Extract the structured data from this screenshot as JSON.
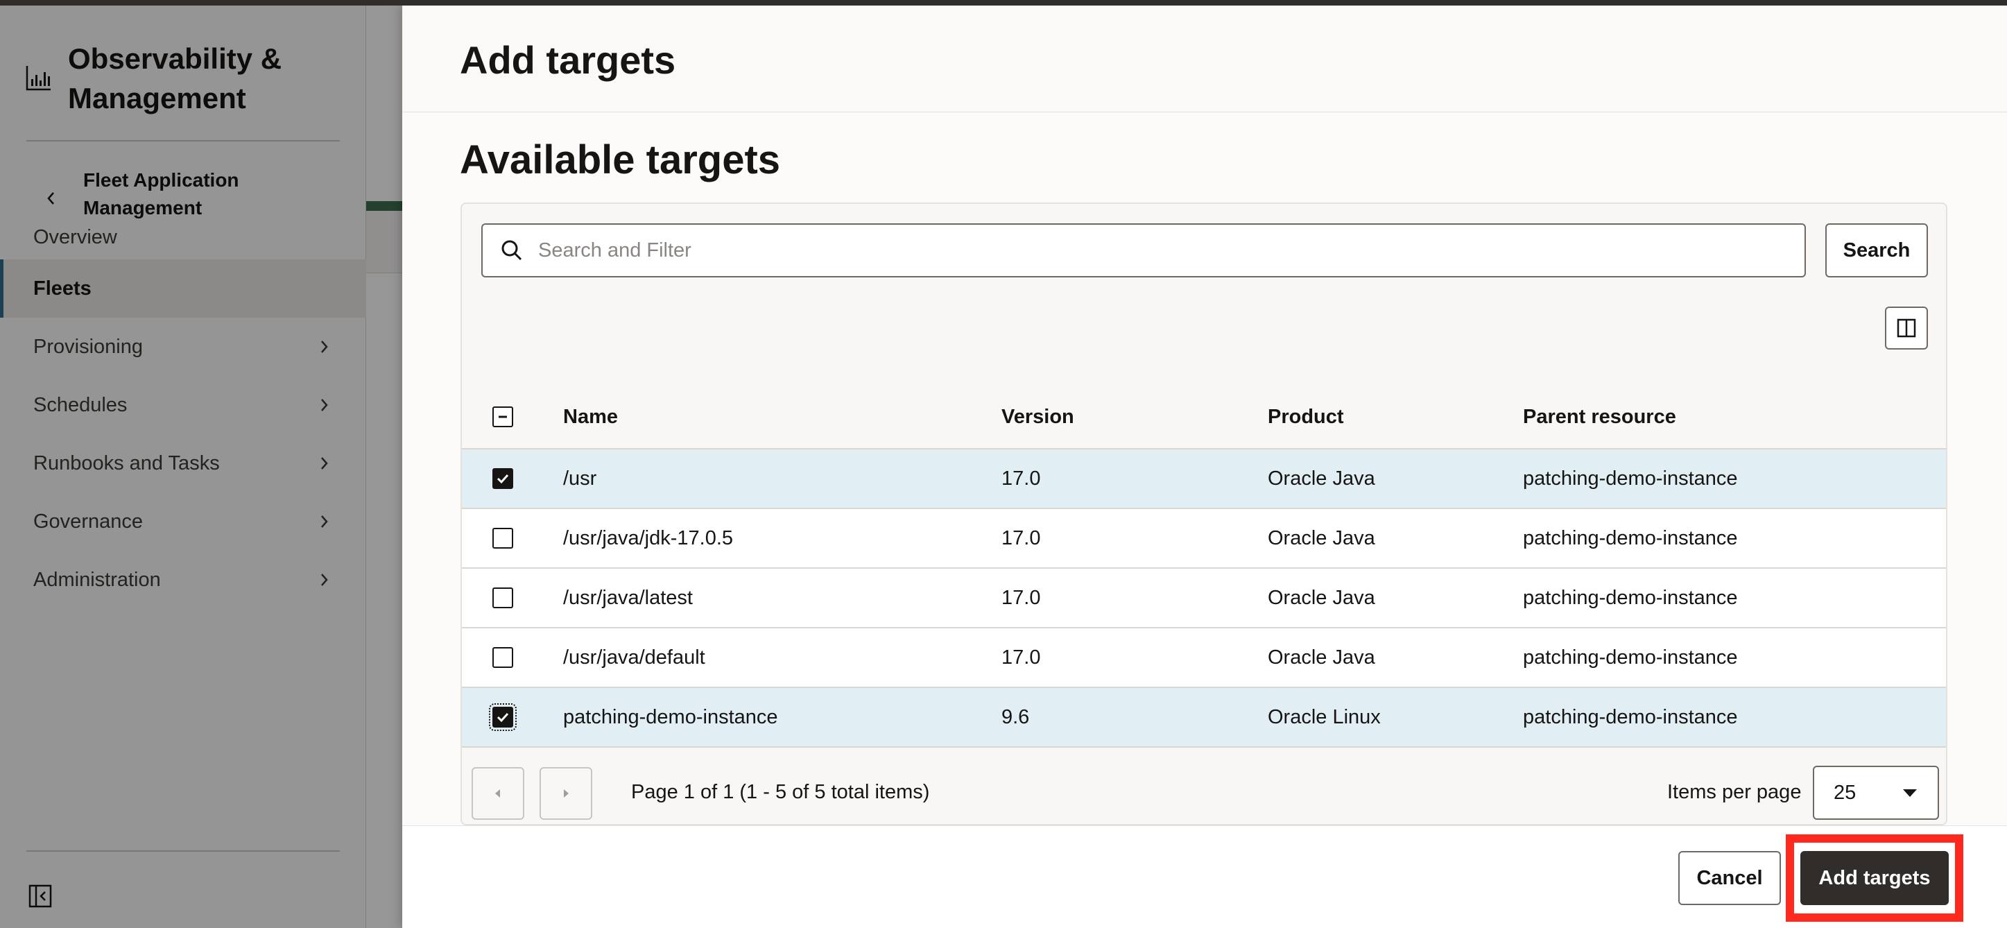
{
  "sidebar": {
    "title": "Observability & Management",
    "back_label": "Fleet Application Management",
    "items": [
      {
        "label": "Overview",
        "has_children": false,
        "active": false
      },
      {
        "label": "Fleets",
        "has_children": false,
        "active": true
      },
      {
        "label": "Provisioning",
        "has_children": true,
        "active": false
      },
      {
        "label": "Schedules",
        "has_children": true,
        "active": false
      },
      {
        "label": "Runbooks and Tasks",
        "has_children": true,
        "active": false
      },
      {
        "label": "Governance",
        "has_children": true,
        "active": false
      },
      {
        "label": "Administration",
        "has_children": true,
        "active": false
      }
    ]
  },
  "drawer": {
    "title": "Add targets",
    "section_title": "Available targets",
    "search": {
      "placeholder": "Search and Filter",
      "value": "",
      "button_label": "Search"
    },
    "table": {
      "headers": {
        "name": "Name",
        "version": "Version",
        "product": "Product",
        "parent": "Parent resource"
      },
      "rows": [
        {
          "name": "/usr",
          "version": "17.0",
          "product": "Oracle Java",
          "parent": "patching-demo-instance",
          "selected": true
        },
        {
          "name": "/usr/java/jdk-17.0.5",
          "version": "17.0",
          "product": "Oracle Java",
          "parent": "patching-demo-instance",
          "selected": false
        },
        {
          "name": "/usr/java/latest",
          "version": "17.0",
          "product": "Oracle Java",
          "parent": "patching-demo-instance",
          "selected": false
        },
        {
          "name": "/usr/java/default",
          "version": "17.0",
          "product": "Oracle Java",
          "parent": "patching-demo-instance",
          "selected": false
        },
        {
          "name": "patching-demo-instance",
          "version": "9.6",
          "product": "Oracle Linux",
          "parent": "patching-demo-instance",
          "selected": true
        }
      ]
    },
    "pagination": {
      "text": "Page 1 of 1 (1 - 5 of 5 total items)",
      "items_per_page_label": "Items per page",
      "items_per_page_value": "25"
    },
    "footer": {
      "cancel_label": "Cancel",
      "add_label": "Add targets"
    }
  },
  "colors": {
    "selected_row": "#e1eff5",
    "primary_button": "#312d2a",
    "highlight": "#ff2a1d",
    "active_nav_bar": "#2f6a88"
  }
}
